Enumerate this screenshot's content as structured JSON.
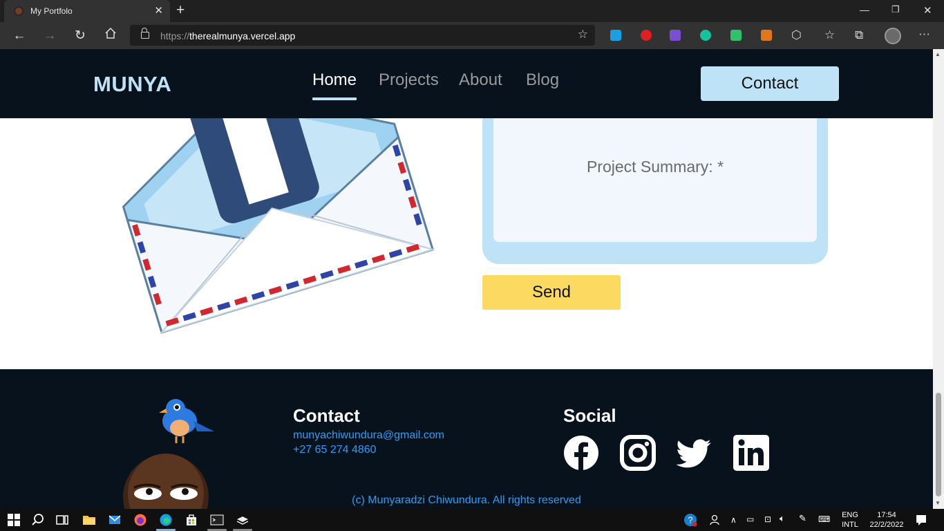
{
  "browser": {
    "tab_title": "My Portfolo",
    "url_scheme": "https://",
    "url_host": "therealmunya.vercel.app"
  },
  "site": {
    "logo": "MUNYA",
    "nav": [
      "Home",
      "Projects",
      "About",
      "Blog"
    ],
    "contact_button": "Contact"
  },
  "form": {
    "textarea_placeholder": "Project Summary: *",
    "send_button": "Send"
  },
  "footer": {
    "contact_heading": "Contact",
    "email": "munyachiwundura@gmail.com",
    "phone": "+27 65 274 4860",
    "social_heading": "Social",
    "social_icons": [
      "facebook-icon",
      "instagram-icon",
      "twitter-icon",
      "linkedin-icon"
    ],
    "copyright": "(c) Munyaradzi Chiwundura. All rights reserved"
  },
  "taskbar": {
    "lang_top": "ENG",
    "lang_bottom": "INTL",
    "time": "17:54",
    "date": "22/2/2022"
  },
  "colors": {
    "nav_bg": "#08121d",
    "accent_blue": "#bfe3f6",
    "send_yellow": "#fcd960",
    "footer_link": "#2f9df5"
  }
}
